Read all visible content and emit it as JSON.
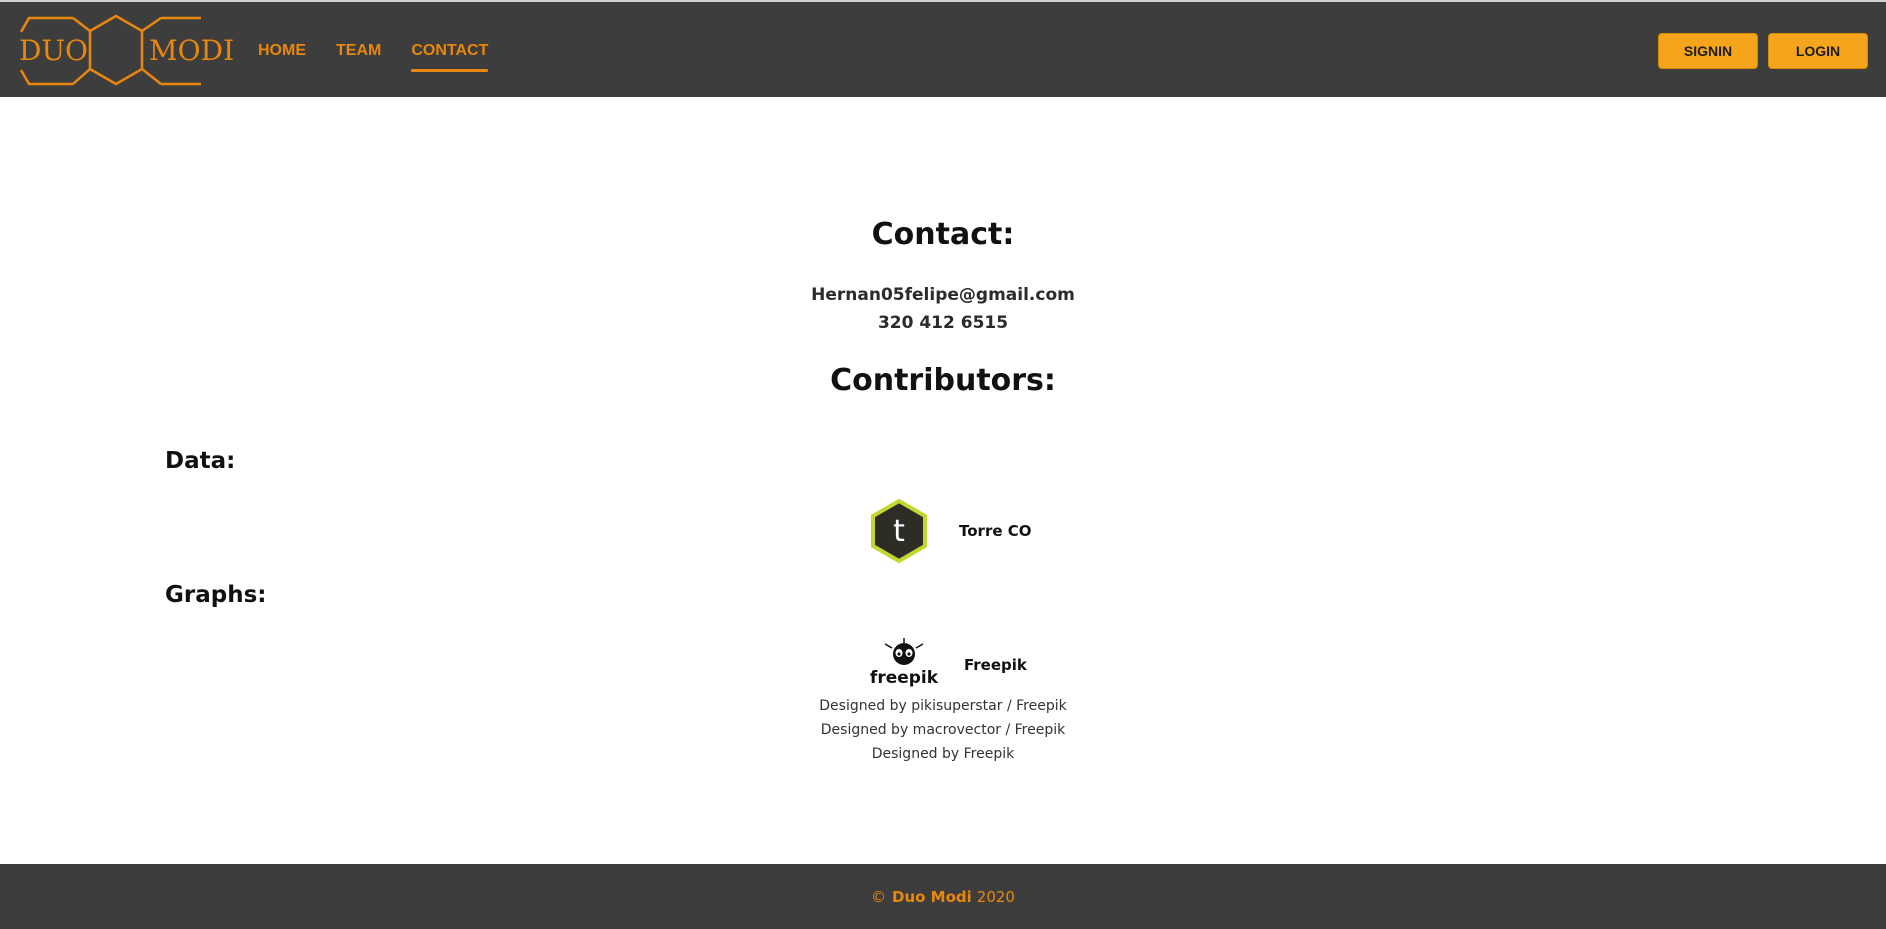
{
  "header": {
    "logo": {
      "left_text": "DUO",
      "right_text": "MODI"
    },
    "nav": [
      {
        "label": "HOME"
      },
      {
        "label": "TEAM"
      },
      {
        "label": "CONTACT"
      }
    ],
    "active_nav": "CONTACT",
    "buttons": {
      "signin": "SIGNIN",
      "login": "LOGIN"
    }
  },
  "main": {
    "contact_heading": "Contact:",
    "email": "Hernan05felipe@gmail.com",
    "phone": "320 412 6515",
    "contributors_heading": "Contributors:",
    "data_label": "Data:",
    "data_contributor": {
      "name": "Torre CO",
      "icon_letter": "t",
      "icon": "torre-logo-icon"
    },
    "graphs_label": "Graphs:",
    "graphs_contributor": {
      "name": "Freepik",
      "icon_text": "freepik",
      "icon": "freepik-logo-icon"
    },
    "credits": [
      "Designed by pikisuperstar / Freepik",
      "Designed by macrovector / Freepik",
      "Designed by Freepik"
    ]
  },
  "footer": {
    "copyright_symbol": "©",
    "brand": "Duo Modi",
    "year": "2020"
  },
  "colors": {
    "header_bg": "#3d3d3d",
    "accent": "#e8870d",
    "button_bg": "#f4a51c",
    "torre_badge": "#c4d630"
  }
}
